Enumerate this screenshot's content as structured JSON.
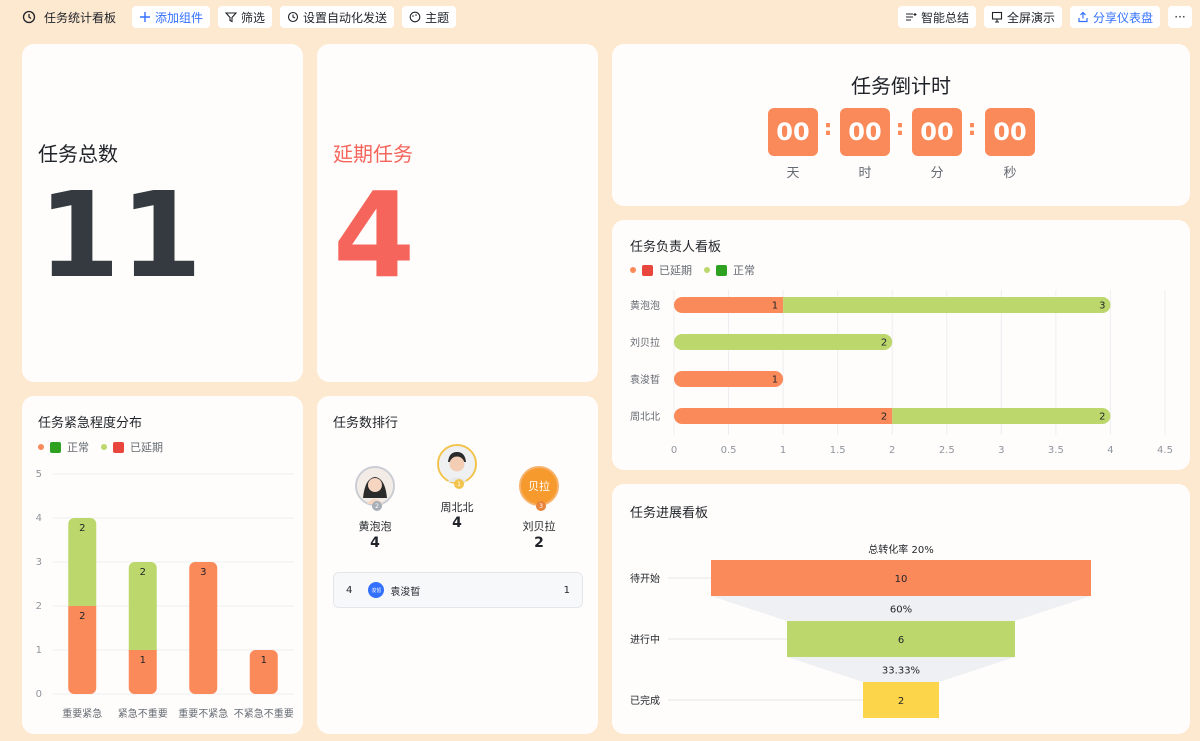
{
  "toolbar": {
    "title": "任务统计看板",
    "add_component": "添加组件",
    "filter": "筛选",
    "automation": "设置自动化发送",
    "theme": "主题",
    "smart_summary": "智能总结",
    "fullscreen": "全屏演示",
    "share": "分享仪表盘",
    "more": "···"
  },
  "total_card": {
    "label": "任务总数",
    "value": "11"
  },
  "delay_card": {
    "label": "延期任务",
    "value": "4"
  },
  "countdown": {
    "title": "任务倒计时",
    "units": [
      {
        "value": "00",
        "label": "天"
      },
      {
        "value": "00",
        "label": "时"
      },
      {
        "value": "00",
        "label": "分"
      },
      {
        "value": "00",
        "label": "秒"
      }
    ],
    "separator": ":"
  },
  "owner_board": {
    "title": "任务负责人看板",
    "legend": [
      "已延期",
      "正常"
    ]
  },
  "urgency_board": {
    "title": "任务紧急程度分布",
    "legend": [
      "正常",
      "已延期"
    ]
  },
  "ranking": {
    "title": "任务数排行",
    "top": [
      {
        "rank": "1",
        "name": "周北北",
        "value": "4"
      },
      {
        "rank": "2",
        "name": "黄泡泡",
        "value": "4"
      },
      {
        "rank": "3",
        "name": "刘贝拉",
        "value": "2",
        "avatar_text": "贝拉"
      }
    ],
    "rows": [
      {
        "rank": "4",
        "name": "袁浚晢",
        "value": "1",
        "avatar_text": "浚晢"
      }
    ]
  },
  "progress_board": {
    "title": "任务进展看板"
  },
  "colors": {
    "orange": "#fb8a5a",
    "green": "#bcd86c",
    "yellow": "#fdd54a",
    "red": "#f5655c",
    "dark": "#343a40"
  },
  "chart_data": [
    {
      "type": "bar",
      "orientation": "horizontal",
      "stacked": true,
      "categories": [
        "黄泡泡",
        "刘贝拉",
        "袁浚晢",
        "周北北"
      ],
      "series": [
        {
          "name": "已延期",
          "values": [
            1,
            0,
            1,
            2
          ]
        },
        {
          "name": "正常",
          "values": [
            3,
            2,
            0,
            2
          ]
        }
      ],
      "xticks": [
        "0",
        "0.5",
        "1",
        "1.5",
        "2",
        "2.5",
        "3",
        "3.5",
        "4",
        "4.5"
      ],
      "xlim": [
        0,
        4.5
      ],
      "grid": true,
      "legend": "top-left"
    },
    {
      "type": "bar",
      "stacked": true,
      "categories": [
        "重要紧急",
        "紧急不重要",
        "重要不紧急",
        "不紧急不重要"
      ],
      "series": [
        {
          "name": "已延期",
          "values": [
            2,
            1,
            3,
            1
          ]
        },
        {
          "name": "正常",
          "values": [
            2,
            2,
            0,
            0
          ]
        }
      ],
      "yticks": [
        "0",
        "1",
        "2",
        "3",
        "4",
        "5"
      ],
      "ylim": [
        0,
        5
      ],
      "grid": true,
      "legend": "top-left"
    },
    {
      "type": "funnel",
      "stages": [
        {
          "name": "待开始",
          "value": 10
        },
        {
          "name": "进行中",
          "value": 6
        },
        {
          "name": "已完成",
          "value": 2
        }
      ],
      "total_rate_label": "总转化率 20%",
      "rates": [
        "60%",
        "33.33%"
      ]
    }
  ]
}
